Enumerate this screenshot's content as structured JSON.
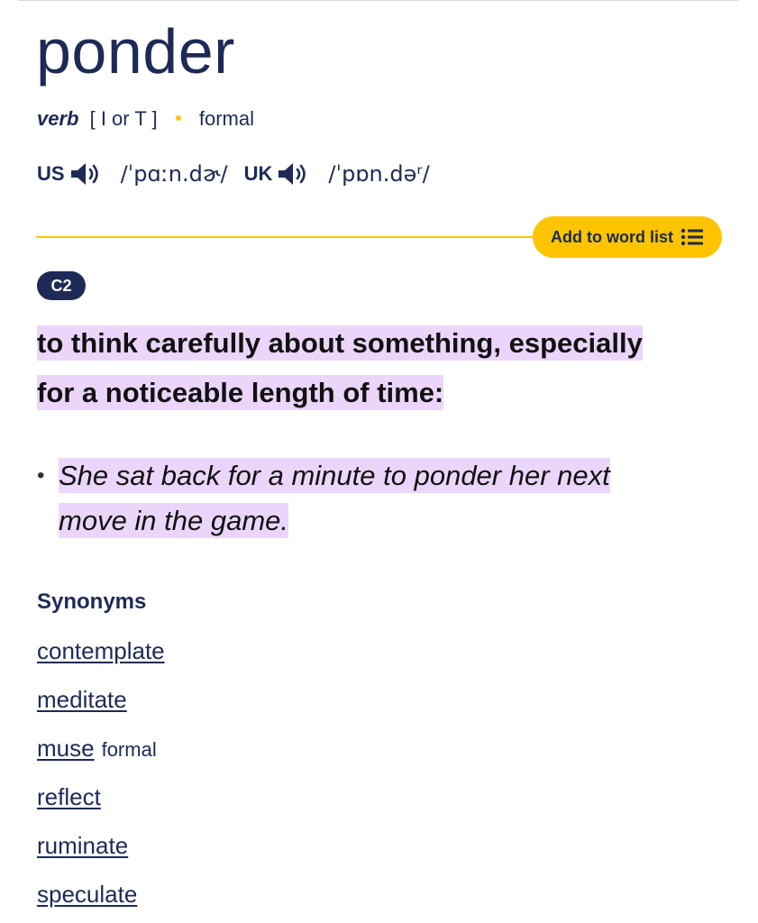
{
  "entry": {
    "headword": "ponder",
    "part_of_speech": "verb",
    "grammar": "[ I or T ]",
    "register": "formal"
  },
  "pronunciation": {
    "us": {
      "region": "US",
      "ipa": "/ˈpɑːn.dɚ/",
      "icon": "speaker-icon"
    },
    "uk": {
      "region": "UK",
      "ipa": "/ˈpɒn.dəʳ/",
      "icon": "speaker-icon"
    }
  },
  "actions": {
    "add_to_word_list": "Add to word list",
    "icon": "list-icon"
  },
  "sense": {
    "level": "C2",
    "definition_line1": "to think carefully about something, especially",
    "definition_line2": "for a noticeable length of time:",
    "example_bullet": "•",
    "example_line1": "She sat back for a minute to ponder her next",
    "example_line2": "move in the game."
  },
  "synonyms": {
    "heading": "Synonyms",
    "items": [
      {
        "word": "contemplate",
        "note": ""
      },
      {
        "word": "meditate",
        "note": ""
      },
      {
        "word": "muse",
        "note": "formal"
      },
      {
        "word": "reflect",
        "note": ""
      },
      {
        "word": "ruminate",
        "note": ""
      },
      {
        "word": "speculate",
        "note": ""
      }
    ]
  },
  "colors": {
    "navy": "#1d2a57",
    "accent_yellow": "#fec400",
    "highlight_purple": "#ecd5fb"
  }
}
